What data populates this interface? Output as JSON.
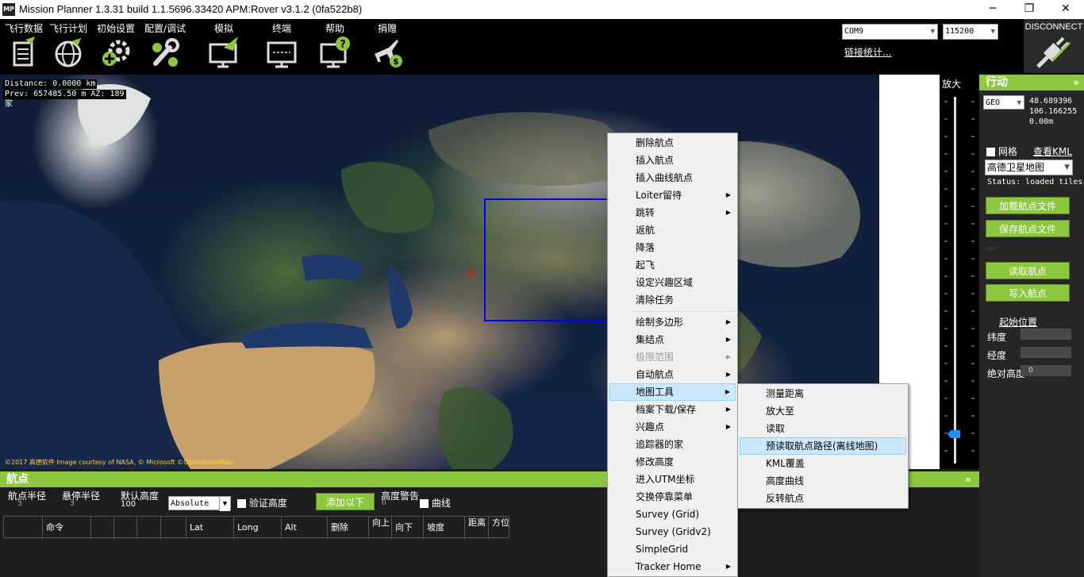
{
  "window": {
    "title": "Mission Planner 1.3.31 build 1.1.5696.33420 APM:Rover v3.1.2 (0fa522b8)",
    "app_icon": "MP",
    "minimize": "─",
    "maximize": "❐",
    "close": "✕"
  },
  "toolbar": {
    "items": [
      {
        "label": "飞行数据",
        "icon": "flight-data-icon"
      },
      {
        "label": "飞行计划",
        "icon": "flight-plan-icon"
      },
      {
        "label": "初始设置",
        "icon": "initial-setup-icon"
      },
      {
        "label": "配置/调试",
        "icon": "config-tuning-icon"
      },
      {
        "label": "模拟",
        "icon": "simulation-icon"
      },
      {
        "label": "终端",
        "icon": "terminal-icon"
      },
      {
        "label": "帮助",
        "icon": "help-icon"
      },
      {
        "label": "捐赠",
        "icon": "donate-icon"
      }
    ],
    "port": "COM9",
    "baud": "115200",
    "link_stats": "链接统计...",
    "disconnect": "DISCONNECT"
  },
  "map": {
    "distance": "Distance: 0.0000 km",
    "prev": "Prev: 657485.50 m AZ: 189",
    "home": "家",
    "copyright": "©2017 高德软件 Image courtesy of NASA, © Microsoft ©OpenStreetMap"
  },
  "zoom": {
    "label": "放大"
  },
  "actions": {
    "title": "行动",
    "collapse": "»",
    "coord_mode": "GEO",
    "lat": "48.689396",
    "lng": "106.166255",
    "alt": "0.00m",
    "grid_label": "网格",
    "kml_link": "查看KML",
    "map_type": "高德卫星地图",
    "status": "Status: loaded tiles",
    "load_wp_file": "加载航点文件",
    "save_wp_file": "保存航点文件",
    "dots": "...",
    "read_wp": "读取航点",
    "write_wp": "写入航点",
    "home_link": "起始位置",
    "lat_label": "纬度",
    "lng_label": "经度",
    "abs_alt_label": "绝对高度",
    "abs_alt_value": "0"
  },
  "waypoints": {
    "title": "航点",
    "collapse": "»",
    "wp_radius_label": "航点半径",
    "wp_radius": "3",
    "loiter_radius_label": "悬停半径",
    "loiter_radius": "3",
    "default_alt_label": "默认高度",
    "default_alt": "100",
    "alt_mode": "Absolute",
    "verify_height": "验证高度",
    "add_below": "添加以下",
    "alt_warn_label": "高度警告",
    "alt_warn": "0",
    "spline": "曲线",
    "columns": [
      "",
      "命令",
      "",
      "",
      "",
      "",
      "Lat",
      "Long",
      "Alt",
      "删除",
      "向上",
      "向下",
      "坡度",
      "距离",
      "方位"
    ]
  },
  "context_menu": {
    "items": [
      {
        "label": "删除航点"
      },
      {
        "label": "插入航点"
      },
      {
        "label": "插入曲线航点"
      },
      {
        "label": "Loiter留待",
        "sub": "▶"
      },
      {
        "label": "跳转",
        "sub": "▶"
      },
      {
        "label": "返航"
      },
      {
        "label": "降落"
      },
      {
        "label": "起飞"
      },
      {
        "label": "设定兴趣区域"
      },
      {
        "label": "清除任务"
      },
      {
        "label": "绘制多边形",
        "sub": "▶"
      },
      {
        "label": "集结点",
        "sub": "▶"
      },
      {
        "label": "极限范围",
        "sub": "▶"
      },
      {
        "label": "自动航点",
        "sub": "▶"
      },
      {
        "label": "地图工具",
        "sub": "▶"
      },
      {
        "label": "档案下载/保存",
        "sub": "▶"
      },
      {
        "label": "兴趣点",
        "sub": "▶"
      },
      {
        "label": "追踪器的家"
      },
      {
        "label": "修改高度"
      },
      {
        "label": "进入UTM坐标"
      },
      {
        "label": "交换停靠菜单"
      },
      {
        "label": "Survey (Grid)"
      },
      {
        "label": "Survey (Gridv2)"
      },
      {
        "label": "SimpleGrid"
      },
      {
        "label": "Tracker Home",
        "sub": "▶"
      }
    ]
  },
  "submenu": {
    "items": [
      {
        "label": "测量距离"
      },
      {
        "label": "放大至"
      },
      {
        "label": "读取"
      },
      {
        "label": "预读取航点路径(离线地图)"
      },
      {
        "label": "KML覆盖"
      },
      {
        "label": "高度曲线"
      },
      {
        "label": "反转航点"
      }
    ]
  },
  "colors": {
    "accent_green": "#8dc63f",
    "menu_highlight": "#cce8ff",
    "selection_rect": "#0000ff",
    "zoom_slider": "#1e90ff"
  }
}
